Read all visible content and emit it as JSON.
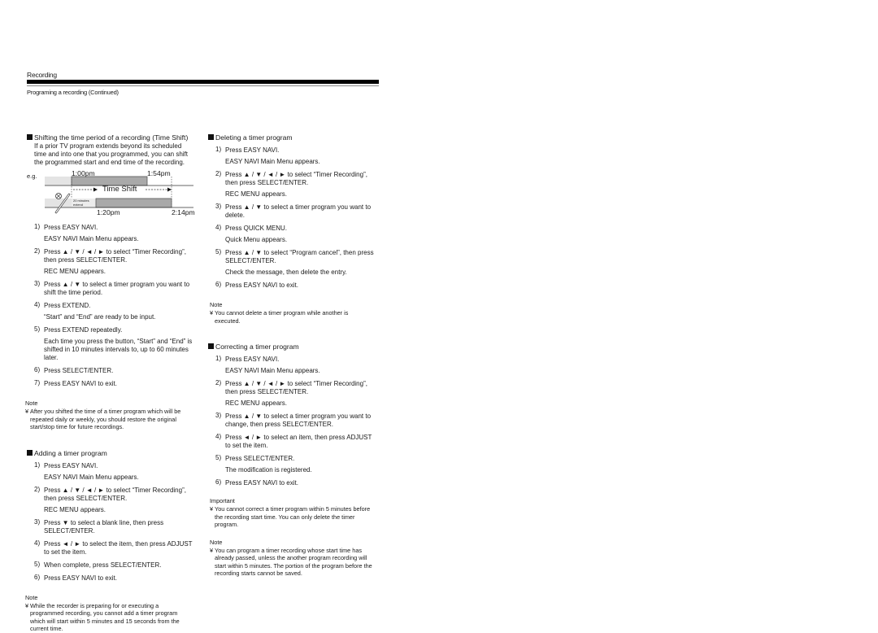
{
  "header": {
    "section": "Recording",
    "subtitle": "Programing a recording (Continued)"
  },
  "time_shift": {
    "heading": "Shifting the time period of a recording (Time Shift)",
    "intro": "If a prior TV program extends beyond its scheduled time and into one that you programmed, you can shift the programmed start and end time of the recording.",
    "diagram": {
      "eg_label": "e.g.",
      "original_start": "1:00pm",
      "original_end": "1:54pm",
      "shift_label": "Time Shift",
      "extend_label_line1": "20 minutes",
      "extend_label_line2": "extend",
      "shifted_start": "1:20pm",
      "shifted_end": "2:14pm",
      "icon": "sports-bat-ball-icon"
    },
    "steps": [
      {
        "num": "1)",
        "lines": [
          "Press EASY NAVI.",
          "EASY NAVI Main Menu appears."
        ]
      },
      {
        "num": "2)",
        "lines": [
          "Press ▲ / ▼ / ◄ / ► to select “Timer Recording”, then press SELECT/ENTER.",
          "REC MENU appears."
        ]
      },
      {
        "num": "3)",
        "lines": [
          "Press ▲ / ▼ to select a timer program you want to shift the time period."
        ]
      },
      {
        "num": "4)",
        "lines": [
          "Press EXTEND.",
          "“Start” and “End” are ready to be input."
        ]
      },
      {
        "num": "5)",
        "lines": [
          "Press EXTEND repeatedly.",
          "Each time you press the button, “Start” and “End” is shifted in 10 minutes intervals to, up to 60 minutes later."
        ]
      },
      {
        "num": "6)",
        "lines": [
          "Press SELECT/ENTER."
        ]
      },
      {
        "num": "7)",
        "lines": [
          "Press EASY NAVI to exit."
        ]
      }
    ],
    "note_title": "Note",
    "note_mark": "¥",
    "note": "After you shifted the time of a timer program which will be repeated daily or weekly, you should restore the original start/stop time for future recordings."
  },
  "adding": {
    "heading": "Adding a timer program",
    "steps": [
      {
        "num": "1)",
        "lines": [
          "Press EASY NAVI.",
          "EASY NAVI Main Menu appears."
        ]
      },
      {
        "num": "2)",
        "lines": [
          "Press ▲ / ▼ / ◄ / ► to select “Timer Recording”, then press SELECT/ENTER.",
          "REC MENU appears."
        ]
      },
      {
        "num": "3)",
        "lines": [
          "Press ▼ to select a blank line, then press SELECT/ENTER."
        ]
      },
      {
        "num": "4)",
        "lines": [
          "Press ◄ / ► to select the item, then press ADJUST to set the item."
        ]
      },
      {
        "num": "5)",
        "lines": [
          "When complete, press SELECT/ENTER."
        ]
      },
      {
        "num": "6)",
        "lines": [
          "Press EASY NAVI to exit."
        ]
      }
    ],
    "note_title": "Note",
    "note_mark": "¥",
    "note": "While the recorder is preparing for or executing a programmed recording, you cannot add a timer program which will start within 5 minutes and 15 seconds from the current time."
  },
  "deleting": {
    "heading": "Deleting a timer program",
    "steps": [
      {
        "num": "1)",
        "lines": [
          "Press EASY NAVI.",
          "EASY NAVI Main Menu appears."
        ]
      },
      {
        "num": "2)",
        "lines": [
          "Press ▲ / ▼ / ◄ / ► to select “Timer Recording”, then press SELECT/ENTER.",
          "REC MENU appears."
        ]
      },
      {
        "num": "3)",
        "lines": [
          "Press ▲ / ▼ to select a timer program you want to delete."
        ]
      },
      {
        "num": "4)",
        "lines": [
          "Press QUICK MENU.",
          "Quick Menu appears."
        ]
      },
      {
        "num": "5)",
        "lines": [
          "Press ▲ / ▼ to select “Program cancel”, then press SELECT/ENTER.",
          "Check the message, then delete the entry."
        ]
      },
      {
        "num": "6)",
        "lines": [
          "Press EASY NAVI to exit."
        ]
      }
    ],
    "note_title": "Note",
    "note_mark": "¥",
    "note": "You cannot delete a timer program while another is executed."
  },
  "correcting": {
    "heading": "Correcting a timer program",
    "steps": [
      {
        "num": "1)",
        "lines": [
          "Press EASY NAVI.",
          "EASY NAVI Main Menu appears."
        ]
      },
      {
        "num": "2)",
        "lines": [
          "Press ▲ / ▼ / ◄ / ► to select “Timer Recording”, then press SELECT/ENTER.",
          "REC MENU appears."
        ]
      },
      {
        "num": "3)",
        "lines": [
          "Press ▲ / ▼ to select a timer program you want to change, then press SELECT/ENTER."
        ]
      },
      {
        "num": "4)",
        "lines": [
          "Press ◄ / ► to select an item, then press ADJUST to set the item."
        ]
      },
      {
        "num": "5)",
        "lines": [
          "Press SELECT/ENTER.",
          "The modification is registered."
        ]
      },
      {
        "num": "6)",
        "lines": [
          "Press EASY NAVI to exit."
        ]
      }
    ],
    "important_title": "Important",
    "important_mark": "¥",
    "important": "You cannot correct a timer program within 5 minutes before the recording start time. You can only delete the timer program.",
    "note_title": "Note",
    "note_mark": "¥",
    "note": "You can program a timer recording whose start time has already passed, unless the another program recording will start within 5 minutes. The portion of the program before the recording starts cannot be saved."
  }
}
